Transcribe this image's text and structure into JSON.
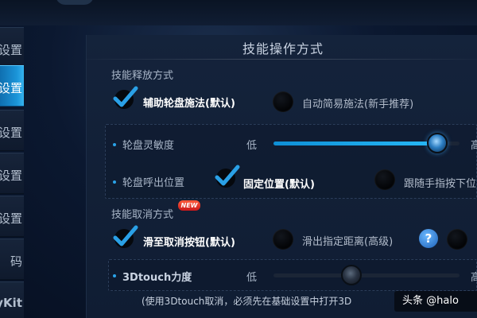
{
  "sidebar": {
    "items": [
      {
        "label": "设置"
      },
      {
        "label": "设置"
      },
      {
        "label": "设置"
      },
      {
        "label": "设置"
      },
      {
        "label": "设置"
      },
      {
        "label": "码"
      },
      {
        "label": "yKit"
      }
    ],
    "active_index": 1
  },
  "panel": {
    "title": "技能操作方式"
  },
  "release": {
    "section_label": "技能释放方式",
    "option_assist": "辅助轮盘施法(默认)",
    "option_auto": "自动简易施法(新手推荐)",
    "selected": "assist"
  },
  "wheel": {
    "sensitivity_label": "轮盘灵敏度",
    "low_label": "低",
    "high_label": "高",
    "sensitivity_value": 0.88,
    "position_label": "轮盘呼出位置",
    "option_fixed": "固定位置(默认)",
    "option_follow": "跟随手指按下位",
    "position_selected": "fixed"
  },
  "cancel": {
    "section_label": "技能取消方式",
    "new_badge": "NEW",
    "option_slide": "滑至取消按钮(默认)",
    "option_drag": "滑出指定距离(高级)",
    "help_symbol": "?",
    "selected": "slide"
  },
  "touch3d": {
    "label": "3Dtouch力度",
    "low_label": "低",
    "high_label": "高",
    "value": 0.42,
    "footnote": "(使用3Dtouch取消，必须先在基础设置中打开3D"
  },
  "watermark": {
    "text": "头条 @halo"
  },
  "colors": {
    "accent": "#1b94d8",
    "check": "#2aa0e6",
    "badge": "#e0261f"
  },
  "icons": {
    "check": "checkmark-icon",
    "help": "question-mark-icon"
  }
}
